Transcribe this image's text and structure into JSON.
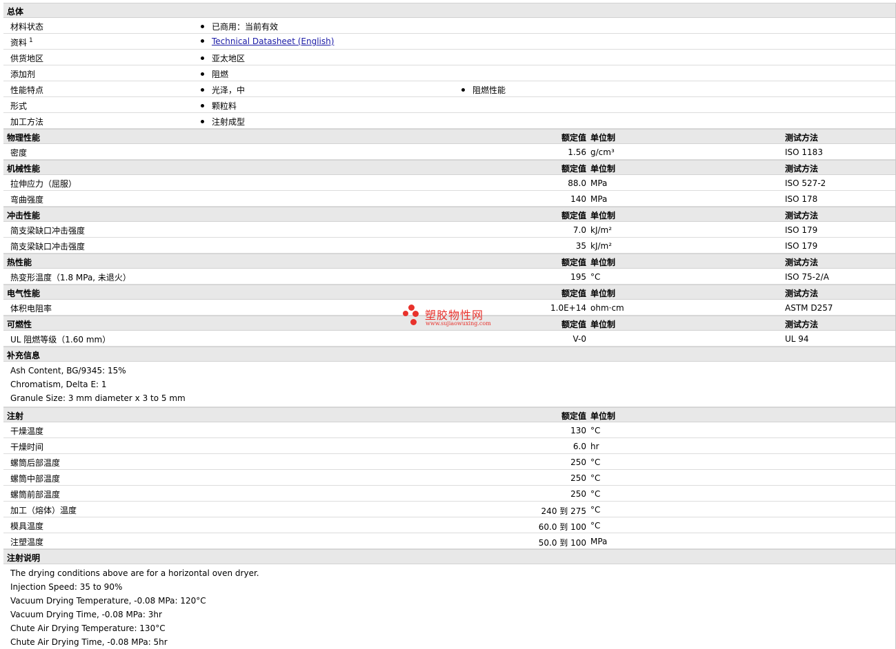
{
  "general": {
    "title": "总体",
    "rows": [
      {
        "label": "材料状态",
        "b1": "已商用：当前有效"
      },
      {
        "label": "资料",
        "sup": "1",
        "b1": "Technical Datasheet (English)"
      },
      {
        "label": "供货地区",
        "b1": "亚太地区"
      },
      {
        "label": "添加剂",
        "b1": "阻燃"
      },
      {
        "label": "性能特点",
        "b1": "光泽，中",
        "b2": "阻燃性能"
      },
      {
        "label": "形式",
        "b1": "颗粒料"
      },
      {
        "label": "加工方法",
        "b1": "注射成型"
      }
    ]
  },
  "col_headers": {
    "value": "额定值",
    "unit": "单位制",
    "test": "测试方法"
  },
  "sections": [
    {
      "title": "物理性能",
      "rows": [
        {
          "label": "密度",
          "value": "1.56",
          "unit": "g/cm³",
          "test": "ISO 1183"
        }
      ]
    },
    {
      "title": "机械性能",
      "rows": [
        {
          "label": "拉伸应力（屈服）",
          "value": "88.0",
          "unit": "MPa",
          "test": "ISO 527-2"
        },
        {
          "label": "弯曲强度",
          "value": "140",
          "unit": "MPa",
          "test": "ISO 178"
        }
      ]
    },
    {
      "title": "冲击性能",
      "rows": [
        {
          "label": "简支梁缺口冲击强度",
          "value": "7.0",
          "unit": "kJ/m²",
          "test": "ISO 179"
        },
        {
          "label": "简支梁缺口冲击强度",
          "value": "35",
          "unit": "kJ/m²",
          "test": "ISO 179"
        }
      ]
    },
    {
      "title": "热性能",
      "rows": [
        {
          "label": "热变形温度（1.8 MPa, 未退火）",
          "value": "195",
          "unit": "°C",
          "test": "ISO 75-2/A"
        }
      ]
    },
    {
      "title": "电气性能",
      "rows": [
        {
          "label": "体积电阻率",
          "value": "1.0E+14",
          "unit": "ohm·cm",
          "test": "ASTM D257"
        }
      ]
    },
    {
      "title": "可燃性",
      "rows": [
        {
          "label": "UL 阻燃等级（1.60 mm）",
          "value": "V-0",
          "unit": "",
          "test": "UL 94"
        }
      ]
    }
  ],
  "supplemental": {
    "title": "补充信息",
    "lines": [
      "Ash Content, BG/9345: 15%",
      "Chromatism, Delta E: 1",
      "Granule Size: 3 mm diameter x 3 to 5 mm"
    ]
  },
  "injection": {
    "title": "注射",
    "rows": [
      {
        "label": "干燥温度",
        "value": "130",
        "unit": "°C"
      },
      {
        "label": "干燥时间",
        "value": "6.0",
        "unit": "hr"
      },
      {
        "label": "螺筒后部温度",
        "value": "250",
        "unit": "°C"
      },
      {
        "label": "螺筒中部温度",
        "value": "250",
        "unit": "°C"
      },
      {
        "label": "螺筒前部温度",
        "value": "250",
        "unit": "°C"
      },
      {
        "label": "加工（熔体）温度",
        "value": "240 到  275",
        "unit": "°C"
      },
      {
        "label": "模具温度",
        "value": "60.0 到  100",
        "unit": "°C"
      },
      {
        "label": "注塑温度",
        "value": "50.0 到  100",
        "unit": "MPa"
      }
    ]
  },
  "injection_notes": {
    "title": "注射说明",
    "lines": [
      "The drying conditions above are for a horizontal oven dryer.",
      "Injection Speed: 35 to 90%",
      "Vacuum Drying Temperature, -0.08 MPa: 120°C",
      "Vacuum Drying Time, -0.08 MPa: 3hr",
      "Chute Air Drying Temperature: 130°C",
      "Chute Air Drying Time, -0.08 MPa: 5hr"
    ]
  },
  "watermark": {
    "name": "塑胶物性网",
    "url": "www.sujiaowuxing.com"
  },
  "colors": {
    "header_bg": "#e8e8e8",
    "link": "#1a1aa6",
    "watermark": "#e8322c"
  }
}
